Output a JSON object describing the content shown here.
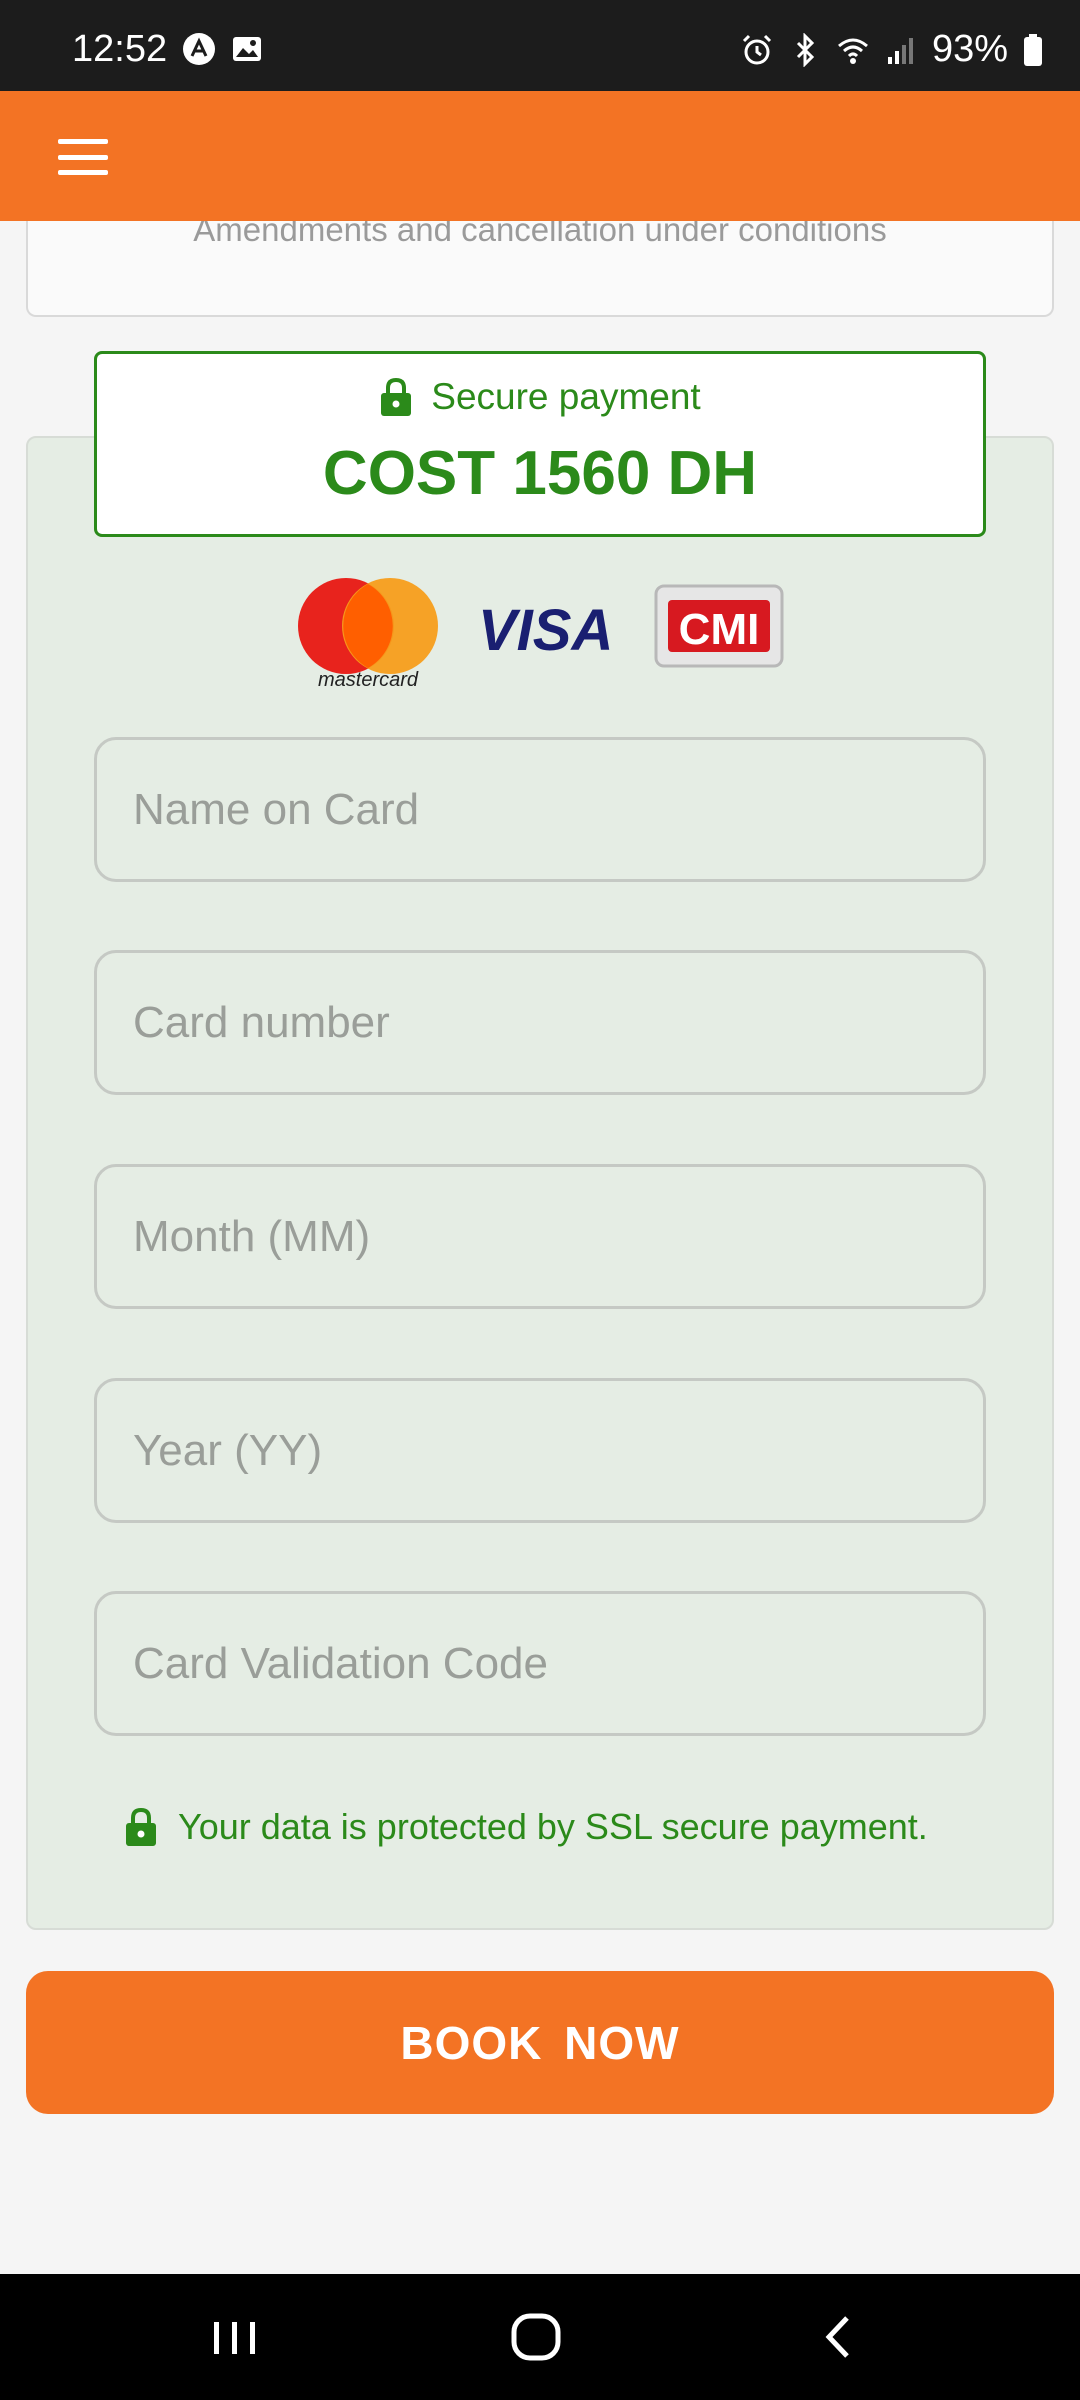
{
  "status_bar": {
    "time": "12:52",
    "battery": "93%",
    "icons": [
      "app-notification-icon",
      "image-icon",
      "alarm-icon",
      "bluetooth-icon",
      "wifi-icon",
      "signal-icon",
      "battery-icon"
    ]
  },
  "app_bar": {
    "menu_icon": "hamburger-menu-icon",
    "color": "#f37324"
  },
  "top_card": {
    "text": "Amendments and cancellation under conditions"
  },
  "payment": {
    "secure_label": "Secure payment",
    "cost": "COST 1560 DH",
    "logos": {
      "mastercard": "mastercard",
      "visa": "VISA",
      "cmi": "CMI"
    },
    "fields": {
      "name_placeholder": "Name on Card",
      "number_placeholder": "Card number",
      "month_placeholder": "Month (MM)",
      "year_placeholder": "Year (YY)",
      "cvc_placeholder": "Card Validation Code"
    },
    "ssl_note": "Your data is protected by SSL secure payment.",
    "accent_color": "#2b8a1a"
  },
  "book_button": {
    "label": "BOOK  NOW"
  },
  "nav_bar": {
    "icons": [
      "recent-apps-icon",
      "home-icon",
      "back-icon"
    ]
  }
}
